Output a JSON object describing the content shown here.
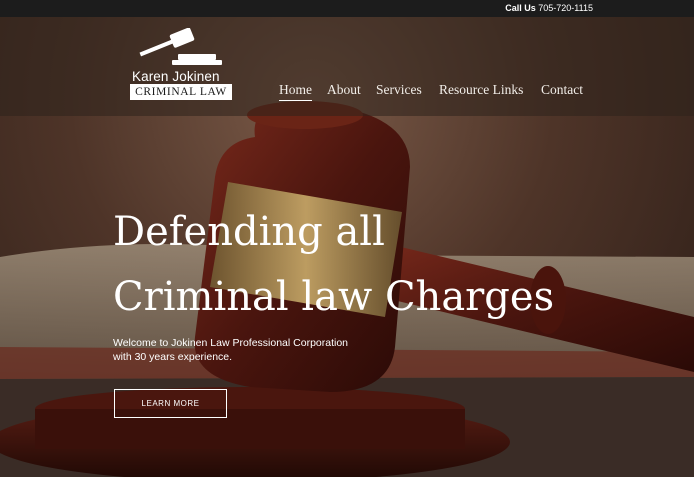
{
  "topbar": {
    "call_label": "Call Us",
    "phone": "705-720-1115"
  },
  "logo": {
    "name": "Karen Jokinen",
    "tagline": "CRIMINAL LAW",
    "icon": "gavel-icon"
  },
  "nav": {
    "items": [
      {
        "label": "Home",
        "active": true
      },
      {
        "label": "About"
      },
      {
        "label": "Services"
      },
      {
        "label": "Resource Links"
      },
      {
        "label": "Contact"
      }
    ]
  },
  "hero": {
    "headline_line1": "Defending all",
    "headline_line2": "Criminal law Charges",
    "intro_line1": "Welcome to Jokinen Law Professional Corporation",
    "intro_line2": "with 30 years experience.",
    "cta_label": "LEARN MORE"
  },
  "colors": {
    "topbar": "#1c1c1c",
    "text": "#ffffff",
    "gavel_wood": "#5a1e14",
    "brass_band": "#a8894f"
  }
}
